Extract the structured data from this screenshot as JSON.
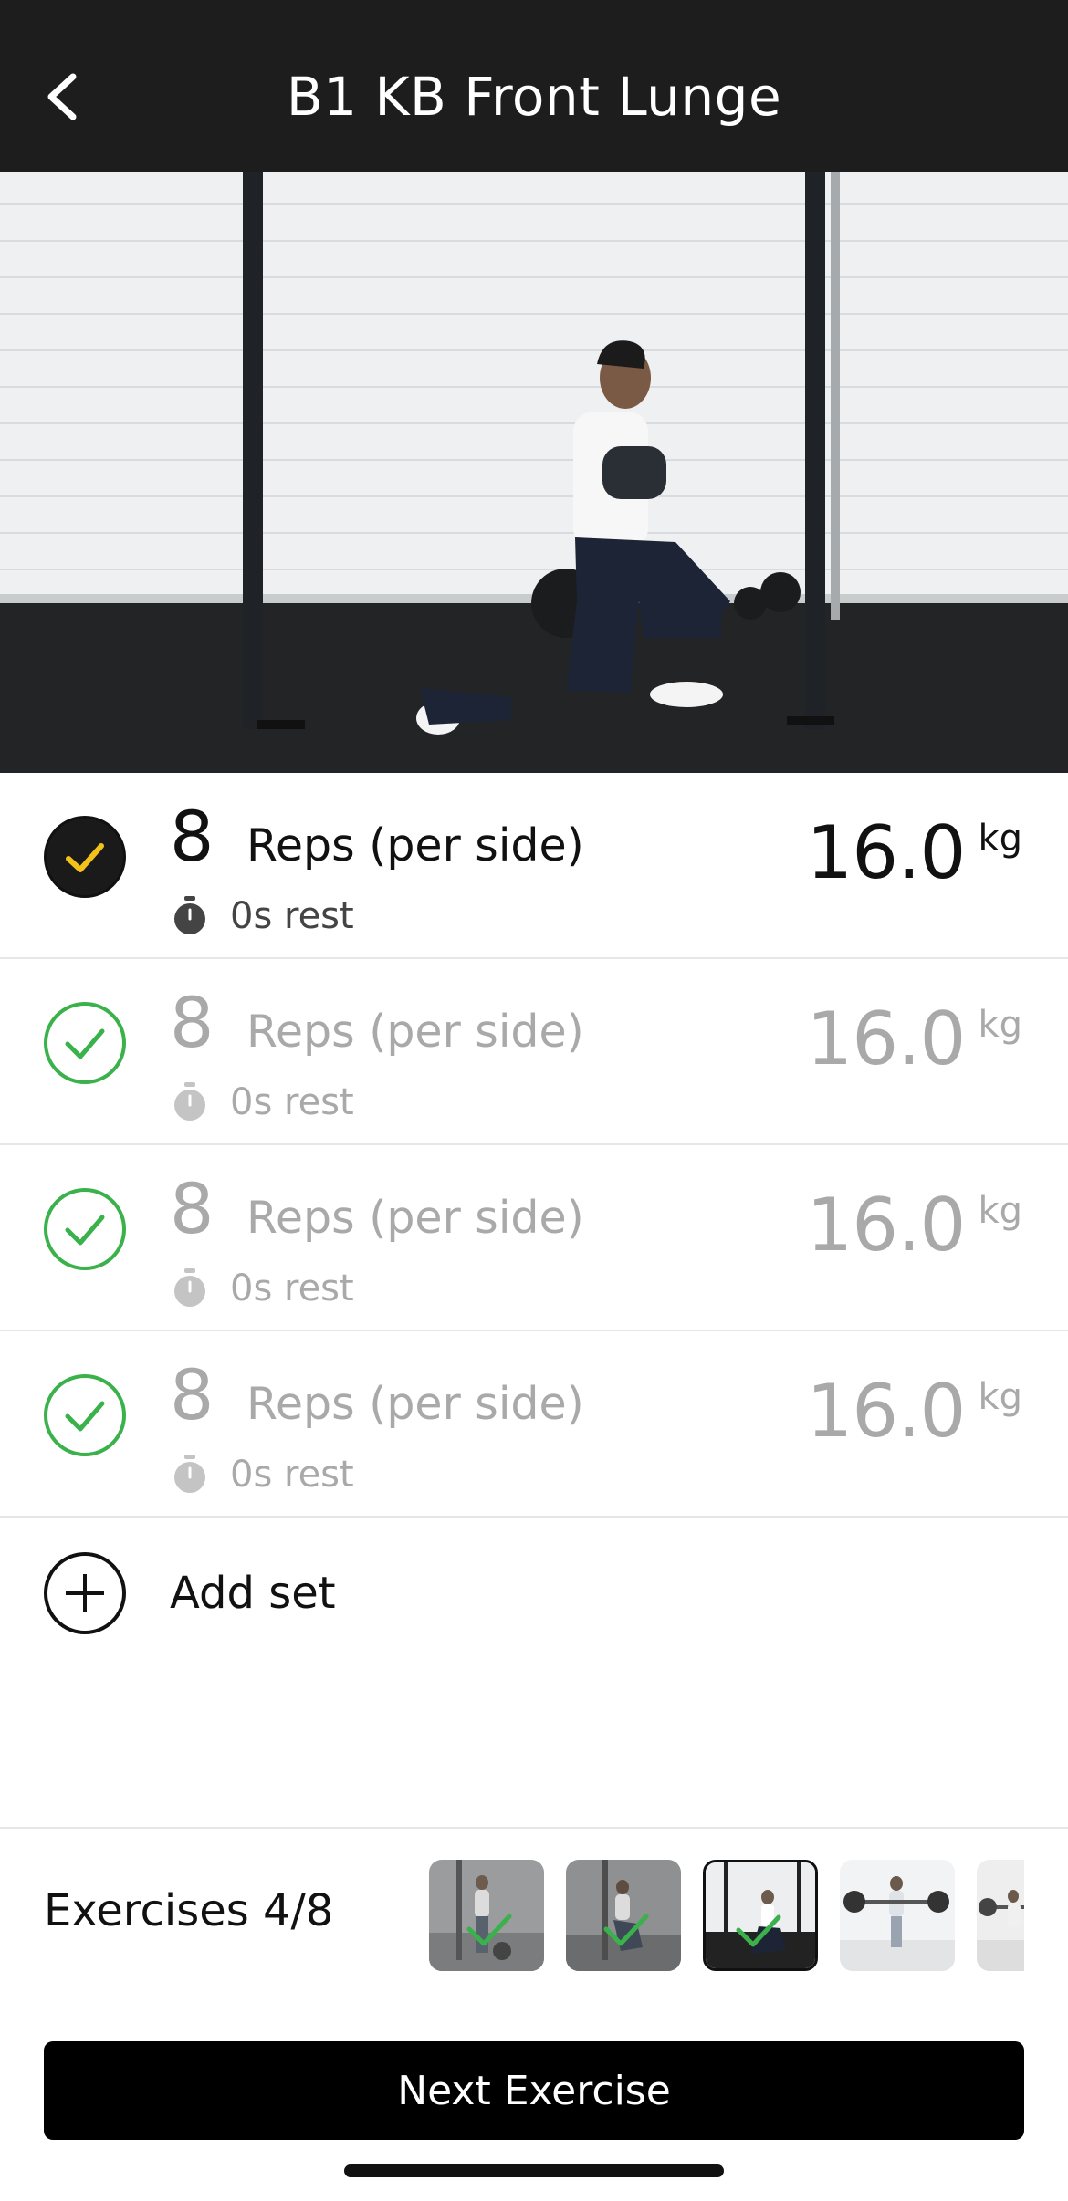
{
  "header": {
    "title": "B1 KB Front Lunge",
    "back_icon": "chevron-left-icon"
  },
  "hero": {
    "image": "man-kettlebell-front-lunge-video-frame"
  },
  "sets": [
    {
      "reps": "8",
      "reps_label": "Reps (per side)",
      "rest": "0s rest",
      "weight": "16.0",
      "unit": "kg",
      "state": "current"
    },
    {
      "reps": "8",
      "reps_label": "Reps (per side)",
      "rest": "0s rest",
      "weight": "16.0",
      "unit": "kg",
      "state": "completed"
    },
    {
      "reps": "8",
      "reps_label": "Reps (per side)",
      "rest": "0s rest",
      "weight": "16.0",
      "unit": "kg",
      "state": "completed"
    },
    {
      "reps": "8",
      "reps_label": "Reps (per side)",
      "rest": "0s rest",
      "weight": "16.0",
      "unit": "kg",
      "state": "completed"
    }
  ],
  "add_set": {
    "label": "Add set"
  },
  "exercises": {
    "label": "Exercises 4/8",
    "thumbnails": [
      {
        "state": "completed"
      },
      {
        "state": "completed"
      },
      {
        "state": "current-completed"
      },
      {
        "state": "upcoming"
      },
      {
        "state": "upcoming"
      }
    ]
  },
  "footer": {
    "next_button": "Next Exercise"
  },
  "colors": {
    "header_bg": "#1d1d1d",
    "check_yellow": "#f2c21b",
    "check_green": "#3ab14a",
    "button_bg": "#000000"
  }
}
